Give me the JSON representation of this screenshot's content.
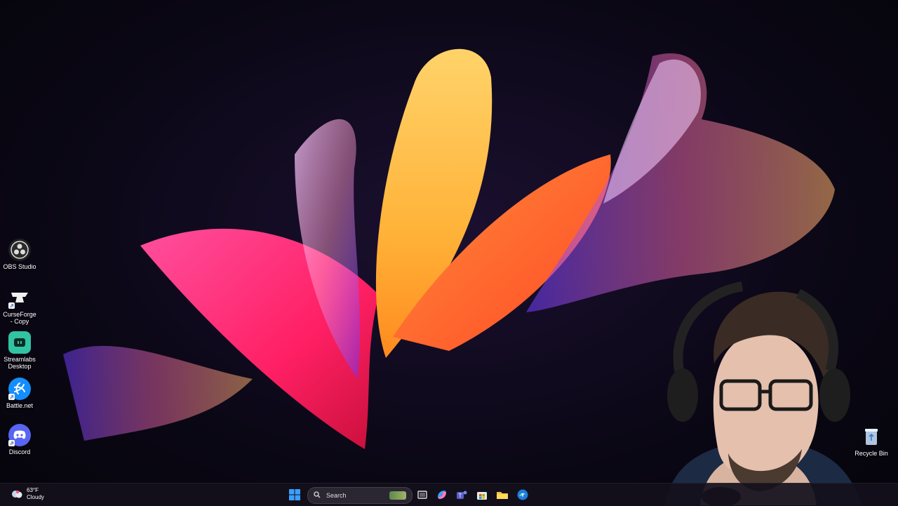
{
  "desktop": {
    "icons": [
      {
        "label": "OBS Studio",
        "icon": "obs-icon"
      },
      {
        "label": "CurseForge - Copy",
        "icon": "curseforge-icon"
      },
      {
        "label": "Streamlabs Desktop",
        "icon": "streamlabs-icon"
      },
      {
        "label": "Battle.net",
        "icon": "battlenet-icon"
      },
      {
        "label": "Discord",
        "icon": "discord-icon"
      }
    ],
    "recycle_bin": {
      "label": "Recycle Bin",
      "icon": "recycle-bin-icon"
    }
  },
  "taskbar": {
    "weather": {
      "temperature": "63°F",
      "condition": "Cloudy",
      "icon": "cloud-icon"
    },
    "search": {
      "placeholder": "Search"
    },
    "apps": [
      "start-icon",
      "task-view-icon",
      "copilot-icon",
      "teams-icon",
      "store-icon",
      "file-explorer-icon",
      "edge-icon"
    ]
  },
  "colors": {
    "accent_start": "#3aa0ff",
    "wallpaper_magenta": "#ff2d7a",
    "wallpaper_orange": "#ffa12a",
    "taskbar_bg": "#14101c"
  }
}
